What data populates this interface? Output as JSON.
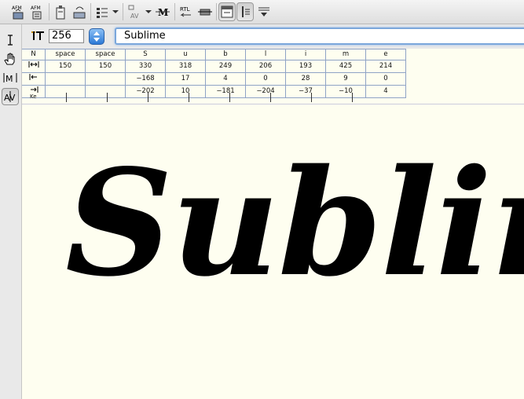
{
  "toolbar": {
    "icons": [
      "afm-import-icon",
      "afm-export-icon",
      "clipboard-icon",
      "paste-icon",
      "view-options-icon",
      "kern-menu-icon",
      "auto-kern-icon",
      "rtl-icon",
      "baseline-icon",
      "view-top-icon",
      "view-side-icon",
      "dropdown-icon"
    ],
    "labels": {
      "afm1": "AFM",
      "afm2": "AFM",
      "rtl": "RTL",
      "av": "AV",
      "m": "M"
    }
  },
  "leftbar": {
    "tools": [
      "text-cursor-icon",
      "hand-icon",
      "metrics-m-icon",
      "kern-av-icon"
    ],
    "labels": {
      "m_tool": "M",
      "av_tool": "AV"
    }
  },
  "size_field": {
    "value": "256"
  },
  "text_field": {
    "value": "Sublime"
  },
  "metrics": {
    "row_labels": [
      "N",
      "width",
      "lbearing",
      "rbearing",
      "Ke"
    ],
    "columns": [
      {
        "name": "space",
        "width": "150",
        "lbearing": "",
        "rbearing": ""
      },
      {
        "name": "space",
        "width": "150",
        "lbearing": "",
        "rbearing": ""
      },
      {
        "name": "S",
        "width": "330",
        "lbearing": "−168",
        "rbearing": "−202"
      },
      {
        "name": "u",
        "width": "318",
        "lbearing": "17",
        "rbearing": "10"
      },
      {
        "name": "b",
        "width": "249",
        "lbearing": "4",
        "rbearing": "−181"
      },
      {
        "name": "l",
        "width": "206",
        "lbearing": "0",
        "rbearing": "−204"
      },
      {
        "name": "i",
        "width": "193",
        "lbearing": "28",
        "rbearing": "−37"
      },
      {
        "name": "m",
        "width": "425",
        "lbearing": "9",
        "rbearing": "−10"
      },
      {
        "name": "e",
        "width": "214",
        "lbearing": "0",
        "rbearing": "4"
      }
    ]
  },
  "canvas": {
    "sample_text": "Sublime"
  }
}
